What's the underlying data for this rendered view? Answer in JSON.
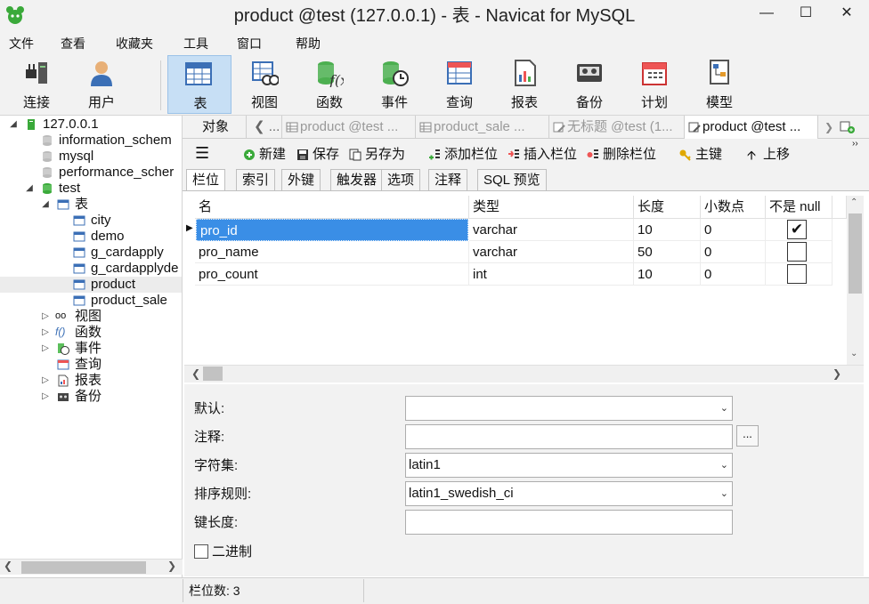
{
  "window": {
    "title": "product @test (127.0.0.1) - 表 - Navicat for MySQL"
  },
  "menu": [
    "文件",
    "查看",
    "收藏夹",
    "工具",
    "窗口",
    "帮助"
  ],
  "ribbon": [
    "连接",
    "用户",
    "表",
    "视图",
    "函数",
    "事件",
    "查询",
    "报表",
    "备份",
    "计划",
    "模型"
  ],
  "tree": {
    "connection": "127.0.0.1",
    "dbs": [
      "information_schem",
      "mysql",
      "performance_scher",
      "test"
    ],
    "group_table": "表",
    "tables": [
      "city",
      "demo",
      "g_cardapply",
      "g_cardapplyde",
      "product",
      "product_sale"
    ],
    "groups": [
      "视图",
      "函数",
      "事件",
      "查询",
      "报表",
      "备份"
    ]
  },
  "tabs": {
    "objects": "对象",
    "ellipsis": "...",
    "items": [
      "product @test ...",
      "product_sale ...",
      "无标题 @test (1...",
      "product @test ..."
    ]
  },
  "toolbar": [
    "新建",
    "保存",
    "另存为",
    "添加栏位",
    "插入栏位",
    "删除栏位",
    "主键",
    "上移"
  ],
  "subtabs": [
    "栏位",
    "索引",
    "外键",
    "触发器",
    "选项",
    "注释",
    "SQL 预览"
  ],
  "grid": {
    "headers": [
      "名",
      "类型",
      "长度",
      "小数点",
      "不是 null"
    ],
    "rows": [
      {
        "name": "pro_id",
        "type": "varchar",
        "length": "10",
        "decimals": "0",
        "notnull": "✔"
      },
      {
        "name": "pro_name",
        "type": "varchar",
        "length": "50",
        "decimals": "0",
        "notnull": ""
      },
      {
        "name": "pro_count",
        "type": "int",
        "length": "10",
        "decimals": "0",
        "notnull": ""
      }
    ]
  },
  "props": {
    "default_label": "默认:",
    "default_value": "",
    "comment_label": "注释:",
    "comment_value": "",
    "charset_label": "字符集:",
    "charset_value": "latin1",
    "collation_label": "排序规则:",
    "collation_value": "latin1_swedish_ci",
    "keylen_label": "键长度:",
    "keylen_value": "",
    "binary_label": "二进制",
    "dots": "..."
  },
  "status": {
    "text": "栏位数: 3"
  }
}
